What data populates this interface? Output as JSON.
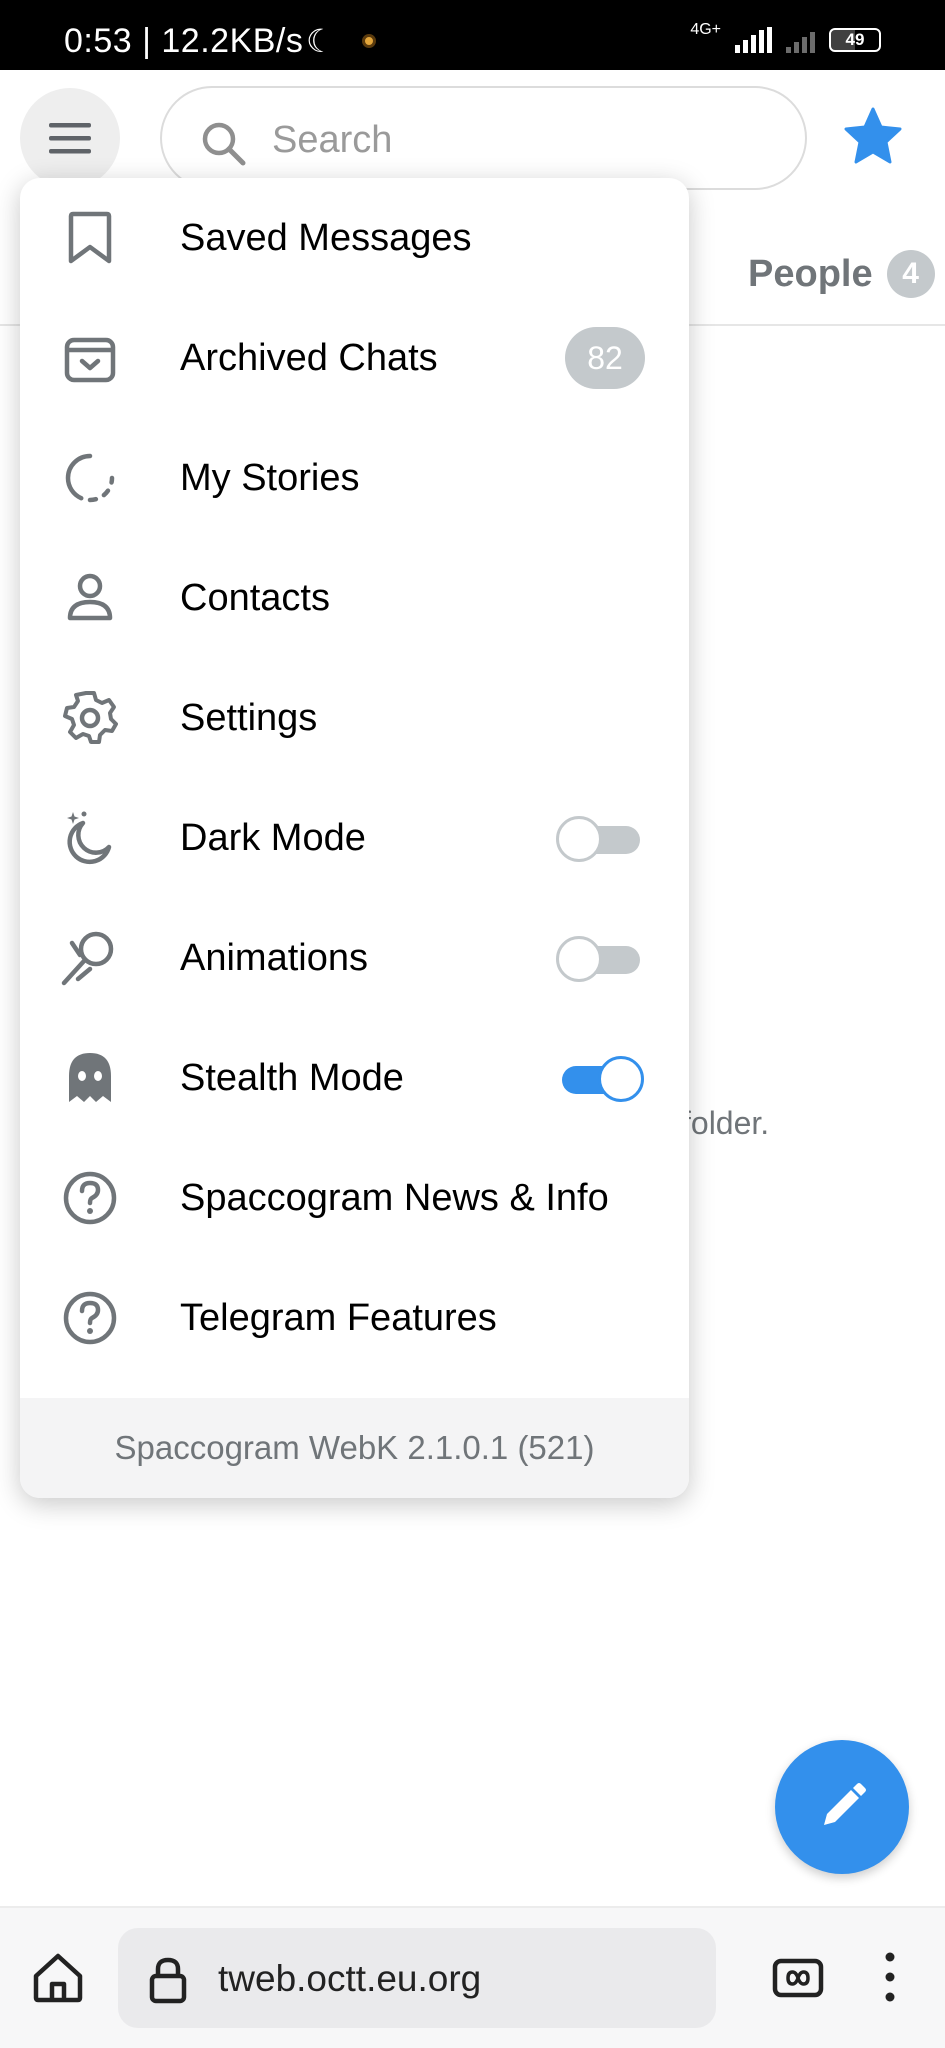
{
  "status_bar": {
    "time_speed": "0:53 | 12.2KB/s",
    "network_label": "4G+",
    "battery": "49"
  },
  "header": {
    "search_placeholder": "Search",
    "tab_people_label": "People",
    "tab_people_count": "4"
  },
  "background": {
    "partial_text": "folder."
  },
  "menu": {
    "items": [
      {
        "label": "Saved Messages",
        "icon": "bookmark-icon"
      },
      {
        "label": "Archived Chats",
        "icon": "archive-icon",
        "count": "82"
      },
      {
        "label": "My Stories",
        "icon": "stories-icon"
      },
      {
        "label": "Contacts",
        "icon": "user-icon"
      },
      {
        "label": "Settings",
        "icon": "gear-icon"
      },
      {
        "label": "Dark Mode",
        "icon": "moon-icon",
        "toggle": false
      },
      {
        "label": "Animations",
        "icon": "animations-icon",
        "toggle": false
      },
      {
        "label": "Stealth Mode",
        "icon": "ghost-icon",
        "toggle": true
      },
      {
        "label": "Spaccogram News & Info",
        "icon": "help-icon"
      },
      {
        "label": "Telegram Features",
        "icon": "help-icon"
      }
    ],
    "footer": "Spaccogram WebK 2.1.0.1 (521)"
  },
  "browser": {
    "url": "tweb.octt.eu.org"
  },
  "colors": {
    "accent": "#3390ec",
    "badge": "#c4c9cc",
    "secondary_text": "#707579"
  }
}
